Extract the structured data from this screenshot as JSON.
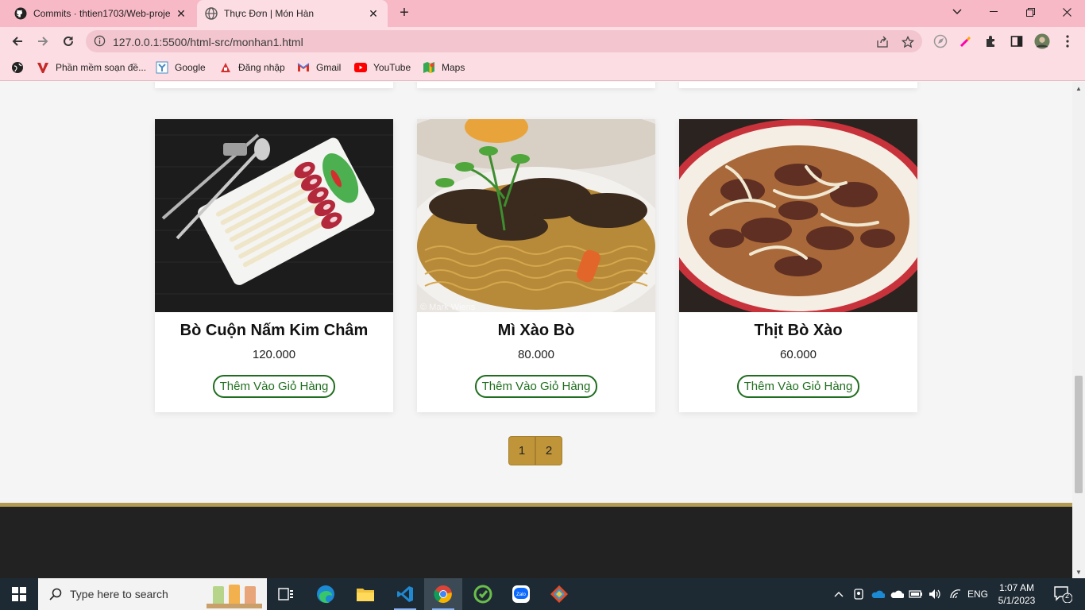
{
  "browser": {
    "tabs": [
      {
        "title": "Commits · thtien1703/Web-proje",
        "close": "✕"
      },
      {
        "title": "Thực Đơn | Món Hàn",
        "close": "✕"
      }
    ],
    "new_tab": "+",
    "address_url": "127.0.0.1:5500/html-src/monhan1.html",
    "bookmarks": [
      {
        "label": "Phần mềm soạn đề...",
        "icon": "v-logo-icon"
      },
      {
        "label": "Google",
        "icon": "google-icon"
      },
      {
        "label": "Đăng nhập",
        "icon": "login-icon"
      },
      {
        "label": "Gmail",
        "icon": "gmail-icon"
      },
      {
        "label": "YouTube",
        "icon": "youtube-icon"
      },
      {
        "label": "Maps",
        "icon": "maps-icon"
      }
    ]
  },
  "menu": {
    "items": [
      {
        "name": "Bò Cuộn Nấm Kim Châm",
        "price": "120.000",
        "button": "Thêm Vào Giỏ Hàng"
      },
      {
        "name": "Mì Xào Bò",
        "price": "80.000",
        "button": "Thêm Vào Giỏ Hàng"
      },
      {
        "name": "Thịt Bò Xào",
        "price": "60.000",
        "button": "Thêm Vào Giỏ Hàng"
      }
    ],
    "pages": [
      "1",
      "2"
    ]
  },
  "taskbar": {
    "search_placeholder": "Type here to search",
    "language": "ENG",
    "time": "1:07 AM",
    "date": "5/1/2023",
    "notification_count": "2"
  },
  "colors": {
    "tabstrip": "#f8b9c6",
    "toolbar": "#fcdde3",
    "pager": "#c0953a",
    "button_green": "#1f6e1f",
    "footer": "#222222",
    "footer_line": "#b39b54"
  }
}
